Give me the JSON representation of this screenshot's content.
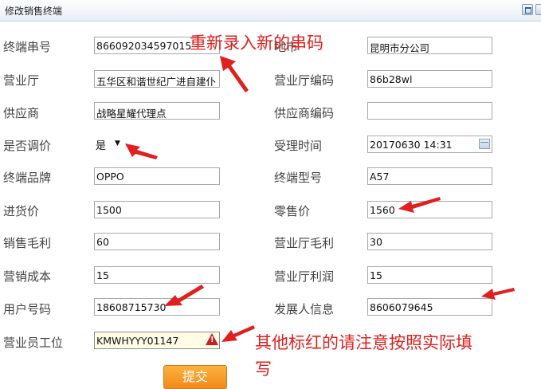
{
  "window": {
    "title": "修改销售终端"
  },
  "form": {
    "left": [
      {
        "label": "终端串号",
        "value": "866092034597015"
      },
      {
        "label": "营业厅",
        "value": "五华区和谐世纪广进自建仆"
      },
      {
        "label": "供应商",
        "value": "战略星耀代理点"
      },
      {
        "label": "是否调价",
        "value": "是"
      },
      {
        "label": "终端品牌",
        "value": "OPPO"
      },
      {
        "label": "进货价",
        "value": "1500"
      },
      {
        "label": "销售毛利",
        "value": "60"
      },
      {
        "label": "营销成本",
        "value": "15"
      },
      {
        "label": "用户号码",
        "value": "18608715730"
      },
      {
        "label": "营业员工位",
        "value": "KMWHYYY01147"
      }
    ],
    "right": [
      {
        "label": "地市",
        "value": "昆明市分公司"
      },
      {
        "label": "营业厅编码",
        "value": "86b28wl"
      },
      {
        "label": "供应商编码",
        "value": ""
      },
      {
        "label": "受理时间",
        "value": "20170630 14:31"
      },
      {
        "label": "终端型号",
        "value": "A57"
      },
      {
        "label": "零售价",
        "value": "1560"
      },
      {
        "label": "营业厅毛利",
        "value": "30"
      },
      {
        "label": "营业厅利润",
        "value": "15"
      },
      {
        "label": "发展人信息",
        "value": "8606079645"
      }
    ],
    "submit_label": "提交"
  },
  "annotations": {
    "top": "重新录入新的串码",
    "bottom_line1": "其他标红的请注意按照实际填",
    "bottom_line2": "写",
    "color": "#e02020"
  }
}
